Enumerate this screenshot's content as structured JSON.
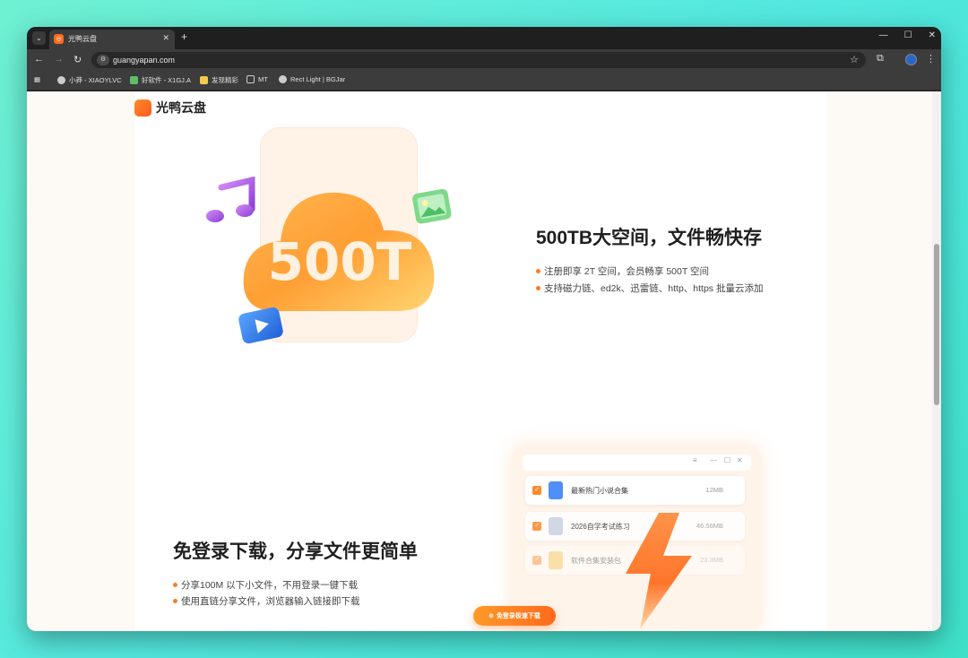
{
  "browser": {
    "tab_title": "光鸭云盘",
    "url": "guangyapan.com",
    "bookmarks": [
      {
        "label": "小莽 - XIAOYLVC",
        "color": "#cccccc"
      },
      {
        "label": "好软件 - X1GJ.A",
        "color": "#5bbf6a"
      },
      {
        "label": "发现精彩",
        "color": "#f2c94c"
      },
      {
        "label": "MT",
        "color": "#cccccc"
      },
      {
        "label": "Rect Light | BGJar",
        "color": "#cccccc"
      }
    ]
  },
  "site": {
    "logo_text": "光鸭云盘"
  },
  "section1": {
    "cloud_label": "500T",
    "headline": "500TB大空间，文件畅快存",
    "bullets": [
      "注册即享 2T 空间，会员畅享 500T 空间",
      "支持磁力链、ed2k、迅雷链、http、https 批量云添加"
    ]
  },
  "section2": {
    "headline": "免登录下载，分享文件更简单",
    "bullets": [
      "分享100M 以下小文件，不用登录一键下载",
      "使用直链分享文件，浏览器输入链接即下载"
    ],
    "files": [
      {
        "name": "最新热门小说合集",
        "size": "12MB",
        "icon_color": "#4f8ff7"
      },
      {
        "name": "2026自学考试练习",
        "size": "46.56MB",
        "icon_color": "#c9d3e3"
      },
      {
        "name": "软件合集安装包",
        "size": "23.3MB",
        "icon_color": "#f7c65a"
      }
    ],
    "download_button": "免登录极速下载"
  },
  "colors": {
    "accent": "#ff7a22",
    "page_bg": "#fdf9f5"
  }
}
